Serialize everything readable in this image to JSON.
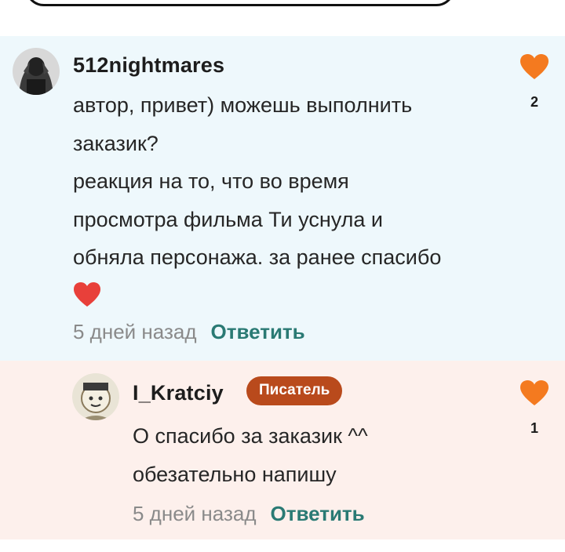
{
  "comments": [
    {
      "username": "512nightmares",
      "text_lines": [
        "автор, привет) можешь выполнить",
        "заказик?",
        "реакция на то, что во время",
        "просмотра фильма Ти уснула и",
        "обняла персонажа. за ранее спасибо"
      ],
      "emoji": "red-heart-emoji",
      "time": "5 дней назад",
      "reply_label": "Ответить",
      "likes": "2",
      "like_icon": "heart-icon",
      "like_color": "#f47a1f",
      "background": "#eef8fc"
    }
  ],
  "reply": {
    "username": "I_Kratciy",
    "badge": "Писатель",
    "badge_color": "#b94a1c",
    "text_lines": [
      "О спасибо за заказик ^^",
      "обезательно напишу"
    ],
    "time": "5 дней назад",
    "reply_label": "Ответить",
    "likes": "1",
    "like_icon": "heart-icon",
    "like_color": "#f47a1f",
    "background": "#fdf0ec"
  },
  "accent_color": "#2a7a74"
}
